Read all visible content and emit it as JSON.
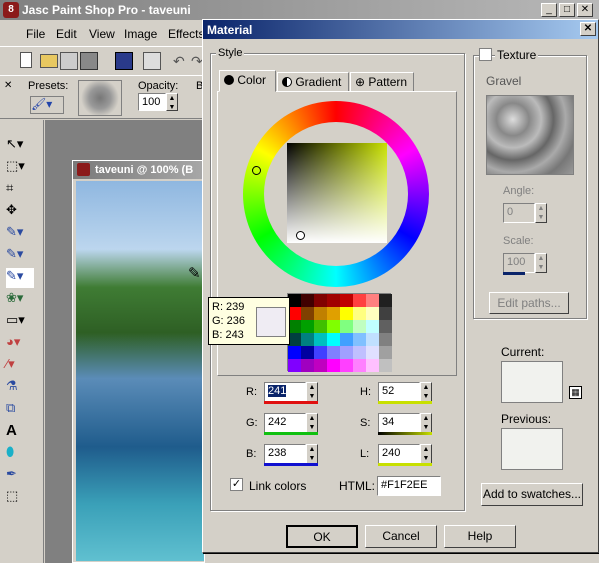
{
  "app": {
    "title": "Jasc Paint Shop Pro - taveuni",
    "icon_label": "8",
    "menu": [
      "File",
      "Edit",
      "View",
      "Image",
      "Effects"
    ],
    "presets_label": "Presets:",
    "opacity_label": "Opacity:",
    "opacity_value": "100",
    "b_label": "B",
    "image_window_title": "taveuni @ 100% (B"
  },
  "dialog": {
    "title": "Material",
    "style_label": "Style",
    "tabs": [
      {
        "label": "Color",
        "icon": "color-dot-icon"
      },
      {
        "label": "Gradient",
        "icon": "gradient-icon"
      },
      {
        "label": "Pattern",
        "icon": "pattern-icon"
      }
    ],
    "tooltip": {
      "r": "R: 239",
      "g": "G: 236",
      "b": "B: 243"
    },
    "rgb": {
      "r_label": "R:",
      "r_value": "241",
      "g_label": "G:",
      "g_value": "242",
      "b_label": "B:",
      "b_value": "238"
    },
    "hsl": {
      "h_label": "H:",
      "h_value": "52",
      "s_label": "S:",
      "s_value": "34",
      "l_label": "L:",
      "l_value": "240"
    },
    "link_colors": "Link colors",
    "link_colors_checked": "✓",
    "html_label": "HTML:",
    "html_value": "#F1F2EE",
    "texture": {
      "label": "Texture",
      "name": "Gravel",
      "angle_label": "Angle:",
      "angle_value": "0",
      "scale_label": "Scale:",
      "scale_value": "100",
      "edit_paths": "Edit paths..."
    },
    "current_label": "Current:",
    "previous_label": "Previous:",
    "add_to_swatches": "Add to swatches...",
    "ok": "OK",
    "cancel": "Cancel",
    "help": "Help",
    "current_color": "#F1F2EE",
    "previous_color": "#F1F2EE"
  }
}
